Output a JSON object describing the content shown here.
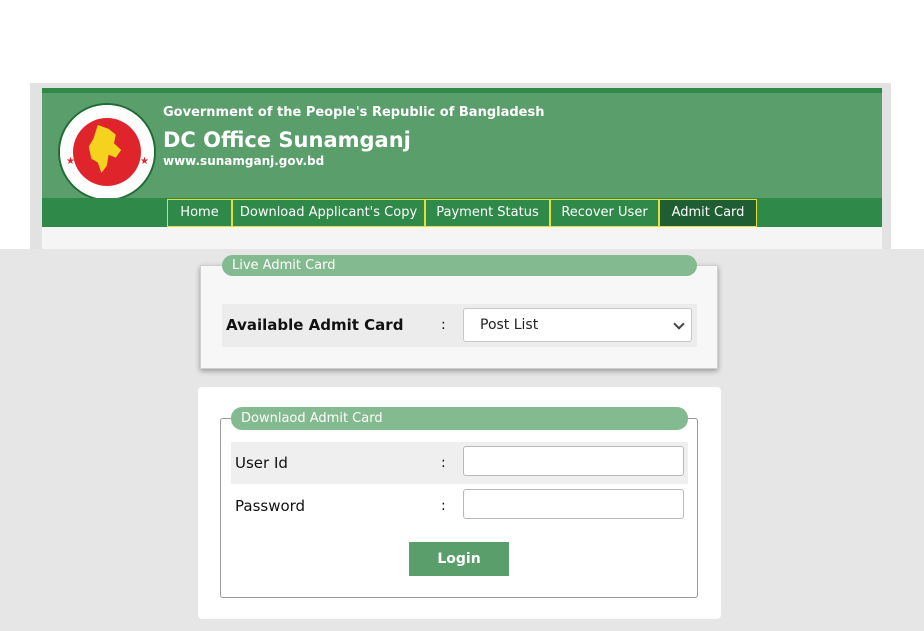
{
  "header": {
    "government_line": "Government of the People's Republic of Bangladesh",
    "office_title": "DC Office Sunamganj",
    "website": "www.sunamganj.gov.bd",
    "logo_icon": "bangladesh-government-seal"
  },
  "nav": {
    "items": [
      {
        "label": "Home"
      },
      {
        "label": "Download Applicant's Copy"
      },
      {
        "label": "Payment Status"
      },
      {
        "label": "Recover User"
      },
      {
        "label": "Admit Card",
        "active": true
      }
    ]
  },
  "live_admit": {
    "legend": "Live Admit Card",
    "available_label": "Available Admit Card",
    "colon": ":",
    "select_value": "Post List"
  },
  "download_admit": {
    "legend": "Downlaod Admit Card",
    "user_id_label": "User Id",
    "password_label": "Password",
    "colon": ":",
    "user_id_value": "",
    "password_value": "",
    "login_label": "Login"
  },
  "colors": {
    "header_green": "#5a9e6b",
    "nav_green": "#2f8a49",
    "nav_active": "#1f5e33",
    "nav_border": "#e6dd3d",
    "legend_green": "#84ba90",
    "logo_red": "#e0242c",
    "logo_yellow": "#f4d21e"
  }
}
